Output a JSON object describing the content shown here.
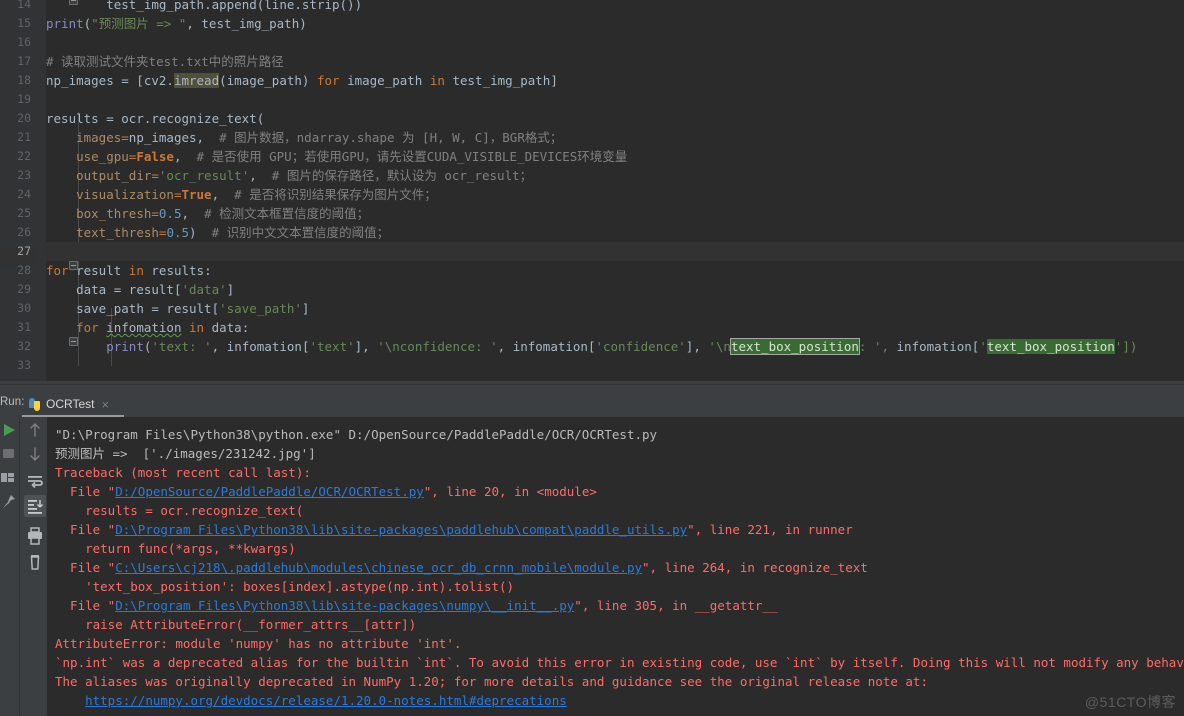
{
  "window": {
    "theme_bg": "#2b2b2b",
    "panel_bg": "#3c3f41",
    "accent": "#287bde"
  },
  "editor": {
    "language": "Python",
    "first_line_number": 14,
    "current_line_number": 27,
    "line_numbers": [
      "14",
      "15",
      "16",
      "17",
      "18",
      "19",
      "20",
      "21",
      "22",
      "23",
      "24",
      "25",
      "26",
      "27",
      "28",
      "29",
      "30",
      "31",
      "32",
      "33"
    ],
    "lines": [
      {
        "n": "14",
        "text": "        test_img_path.append(line.strip())"
      },
      {
        "n": "15",
        "text": "print(\"预测图片 => \", test_img_path)"
      },
      {
        "n": "16",
        "text": ""
      },
      {
        "n": "17",
        "text": "# 读取测试文件夹test.txt中的照片路径"
      },
      {
        "n": "18",
        "text": "np_images = [cv2.imread(image_path) for image_path in test_img_path]"
      },
      {
        "n": "19",
        "text": ""
      },
      {
        "n": "20",
        "text": "results = ocr.recognize_text("
      },
      {
        "n": "21",
        "text": "    images=np_images,  # 图片数据，ndarray.shape 为 [H, W, C]，BGR格式；"
      },
      {
        "n": "22",
        "text": "    use_gpu=False,  # 是否使用 GPU；若使用GPU，请先设置CUDA_VISIBLE_DEVICES环境变量"
      },
      {
        "n": "23",
        "text": "    output_dir='ocr_result',  # 图片的保存路径，默认设为 ocr_result；"
      },
      {
        "n": "24",
        "text": "    visualization=True,  # 是否将识别结果保存为图片文件；"
      },
      {
        "n": "25",
        "text": "    box_thresh=0.5,  # 检测文本框置信度的阈值；"
      },
      {
        "n": "26",
        "text": "    text_thresh=0.5)  # 识别中文文本置信度的阈值；"
      },
      {
        "n": "27",
        "text": ""
      },
      {
        "n": "28",
        "text": "for result in results:"
      },
      {
        "n": "29",
        "text": "    data = result['data']"
      },
      {
        "n": "30",
        "text": "    save_path = result['save_path']"
      },
      {
        "n": "31",
        "text": "    for infomation in data:"
      },
      {
        "n": "32",
        "text": "        print('text: ', infomation['text'], '\\nconfidence: ', infomation['confidence'], '\\ntext_box_position: ', infomation['text_box_position'])"
      },
      {
        "n": "33",
        "text": ""
      }
    ],
    "tokens": {
      "print": "print",
      "string_predict": "\"预测图片 => \"",
      "test_img_path": "test_img_path",
      "comment_read_test": "# 读取测试文件夹test.txt中的照片路径",
      "np_images": "np_images",
      "cv2": "cv2",
      "imread": "imread",
      "image_path": "image_path",
      "kw_for": "for",
      "kw_in": "in",
      "results": "results",
      "ocr_recognize_text": "ocr.recognize_text(",
      "param_images": "images",
      "comment_images": "# 图片数据，ndarray.shape 为 [H, W, C]，BGR格式；",
      "param_use_gpu": "use_gpu",
      "val_false": "False",
      "comment_use_gpu": "# 是否使用 GPU；若使用GPU，请先设置CUDA_VISIBLE_DEVICES环境变量",
      "param_output_dir": "output_dir",
      "val_ocr_result": "'ocr_result'",
      "comment_output_dir": "# 图片的保存路径，默认设为 ocr_result；",
      "param_visualization": "visualization",
      "val_true": "True",
      "comment_visualization": "# 是否将识别结果保存为图片文件；",
      "param_box_thresh": "box_thresh",
      "val_box_thresh": "0.5",
      "comment_box_thresh": "# 检测文本框置信度的阈值；",
      "param_text_thresh": "text_thresh",
      "val_text_thresh": "0.5",
      "comment_text_thresh": "# 识别中文文本置信度的阈值；",
      "result": "result",
      "data": "data",
      "str_data": "'data'",
      "save_path": "save_path",
      "str_save_path": "'save_path'",
      "infomation": "infomation",
      "str_text_label": "'text: '",
      "str_text_key": "'text'",
      "str_confidence_label": "'\\nconfidence: '",
      "str_confidence_key": "'confidence'",
      "str_newline": "'\\n",
      "sel_text_box_position_1": "text_box_position",
      "str_after_sel": ": ',",
      "str_text_box_key": "text_box_position",
      "tail": "'])"
    }
  },
  "run_panel": {
    "label": "Run:",
    "tab_label": "OCRTest",
    "tab_close": "×",
    "toolbar_left": [
      {
        "name": "rerun-icon",
        "title": "Rerun"
      },
      {
        "name": "stop-icon",
        "title": "Stop"
      },
      {
        "name": "layout-icon",
        "title": "Layout"
      },
      {
        "name": "pin-icon",
        "title": "Pin Tab"
      }
    ],
    "toolbar_inner": [
      {
        "name": "up-arrow-icon",
        "title": "Up the Stack Trace"
      },
      {
        "name": "down-arrow-icon",
        "title": "Down the Stack Trace"
      },
      {
        "name": "soft-wrap-icon",
        "title": "Soft-Wrap"
      },
      {
        "name": "scroll-to-end-icon",
        "title": "Scroll to the end",
        "selected": true
      },
      {
        "name": "print-icon",
        "title": "Print"
      },
      {
        "name": "trash-icon",
        "title": "Clear All"
      }
    ]
  },
  "console": {
    "lines": [
      {
        "segments": [
          {
            "text": "\"D:\\Program Files\\Python38\\python.exe\" D:/OpenSource/PaddlePaddle/OCR/OCRTest.py",
            "style": "out"
          }
        ]
      },
      {
        "segments": [
          {
            "text": "预测图片 =>  ['./images/231242.jpg']",
            "style": "out"
          }
        ]
      },
      {
        "segments": [
          {
            "text": "Traceback (most recent call last):",
            "style": "err"
          }
        ]
      },
      {
        "segments": [
          {
            "text": "  File \"",
            "style": "err"
          },
          {
            "text": "D:/OpenSource/PaddlePaddle/OCR/OCRTest.py",
            "style": "link"
          },
          {
            "text": "\", line 20, in <module>",
            "style": "err"
          }
        ]
      },
      {
        "segments": [
          {
            "text": "    results = ocr.recognize_text(",
            "style": "err"
          }
        ]
      },
      {
        "segments": [
          {
            "text": "  File \"",
            "style": "err"
          },
          {
            "text": "D:\\Program Files\\Python38\\lib\\site-packages\\paddlehub\\compat\\paddle_utils.py",
            "style": "link"
          },
          {
            "text": "\", line 221, in runner",
            "style": "err"
          }
        ]
      },
      {
        "segments": [
          {
            "text": "    return func(*args, **kwargs)",
            "style": "err"
          }
        ]
      },
      {
        "segments": [
          {
            "text": "  File \"",
            "style": "err"
          },
          {
            "text": "C:\\Users\\cj218\\.paddlehub\\modules\\chinese_ocr_db_crnn_mobile\\module.py",
            "style": "link"
          },
          {
            "text": "\", line 264, in recognize_text",
            "style": "err"
          }
        ]
      },
      {
        "segments": [
          {
            "text": "    'text_box_position': boxes[index].astype(np.int).tolist()",
            "style": "err"
          }
        ]
      },
      {
        "segments": [
          {
            "text": "  File \"",
            "style": "err"
          },
          {
            "text": "D:\\Program Files\\Python38\\lib\\site-packages\\numpy\\__init__.py",
            "style": "link"
          },
          {
            "text": "\", line 305, in __getattr__",
            "style": "err"
          }
        ]
      },
      {
        "segments": [
          {
            "text": "    raise AttributeError(__former_attrs__[attr])",
            "style": "err"
          }
        ]
      },
      {
        "segments": [
          {
            "text": "AttributeError: module 'numpy' has no attribute 'int'.",
            "style": "err"
          }
        ]
      },
      {
        "segments": [
          {
            "text": "`np.int` was a deprecated alias for the builtin `int`. To avoid this error in existing code, use `int` by itself. Doing this will not modify any behavio",
            "style": "err"
          }
        ]
      },
      {
        "segments": [
          {
            "text": "The aliases was originally deprecated in NumPy 1.20; for more details and guidance see the original release note at:",
            "style": "err"
          }
        ]
      },
      {
        "segments": [
          {
            "text": "    ",
            "style": "err"
          },
          {
            "text": "https://numpy.org/devdocs/release/1.20.0-notes.html#deprecations",
            "style": "link"
          }
        ]
      }
    ]
  },
  "watermark": {
    "text": "@51CTO博客"
  }
}
